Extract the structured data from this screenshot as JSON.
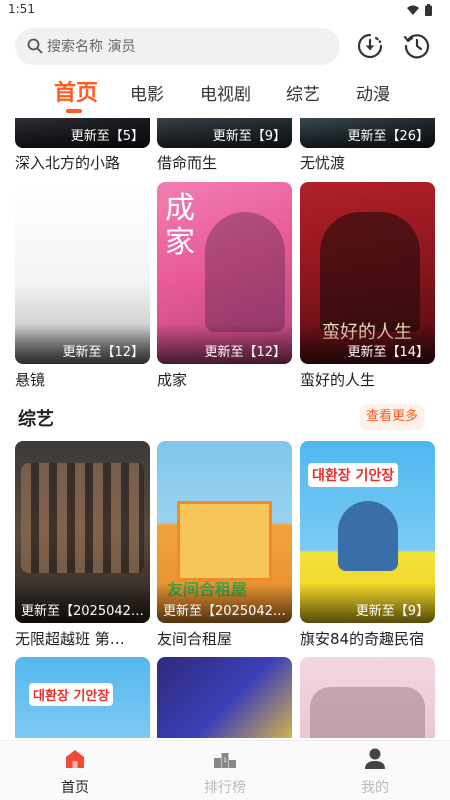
{
  "status": {
    "time": "1:51"
  },
  "search": {
    "placeholder": "搜索名称 演员"
  },
  "tabs": [
    {
      "label": "首页",
      "active": true
    },
    {
      "label": "电影"
    },
    {
      "label": "电视剧"
    },
    {
      "label": "综艺"
    },
    {
      "label": "动漫"
    }
  ],
  "drama": {
    "row1": [
      {
        "title": "深入北方的小路",
        "badge": "更新至【5】"
      },
      {
        "title": "借命而生",
        "badge": "更新至【9】"
      },
      {
        "title": "无忧渡",
        "badge": "更新至【26】"
      }
    ],
    "row2": [
      {
        "title": "悬镜",
        "badge": "更新至【12】"
      },
      {
        "title": "成家",
        "badge": "更新至【12】"
      },
      {
        "title": "蛮好的人生",
        "badge": "更新至【14】"
      }
    ]
  },
  "variety": {
    "section_title": "综艺",
    "more_label": "查看更多",
    "row1": [
      {
        "title": "无限超越班 第…",
        "badge": "更新至【2025042…"
      },
      {
        "title": "友间合租屋",
        "badge": "更新至【2025042…"
      },
      {
        "title": "旗安84的奇趣民宿",
        "badge": "更新至【9】"
      }
    ]
  },
  "bottom_nav": [
    {
      "label": "首页",
      "icon": "home-icon",
      "active": true
    },
    {
      "label": "排行榜",
      "icon": "ranking-podium-icon"
    },
    {
      "label": "我的",
      "icon": "user-icon"
    }
  ],
  "colors": {
    "accent": "#ff5a1f"
  }
}
